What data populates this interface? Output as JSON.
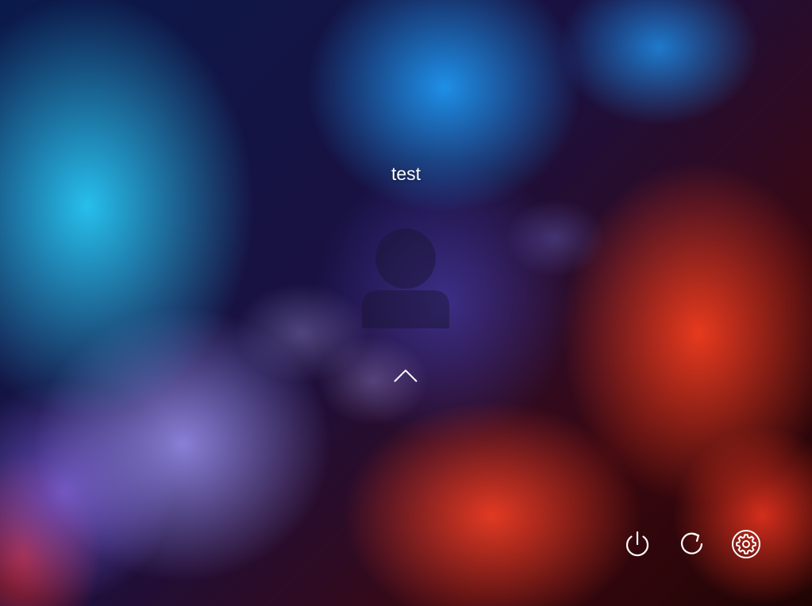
{
  "lock_screen": {
    "username": "test",
    "avatar_icon": "user-icon",
    "unlock_icon": "chevron-up-icon"
  },
  "power_controls": [
    {
      "name": "power-icon"
    },
    {
      "name": "restart-icon"
    },
    {
      "name": "settings-icon"
    }
  ],
  "colors": {
    "text": "#ffffff",
    "background_cool": "#28c8f5",
    "background_warm": "#f03c1e"
  }
}
